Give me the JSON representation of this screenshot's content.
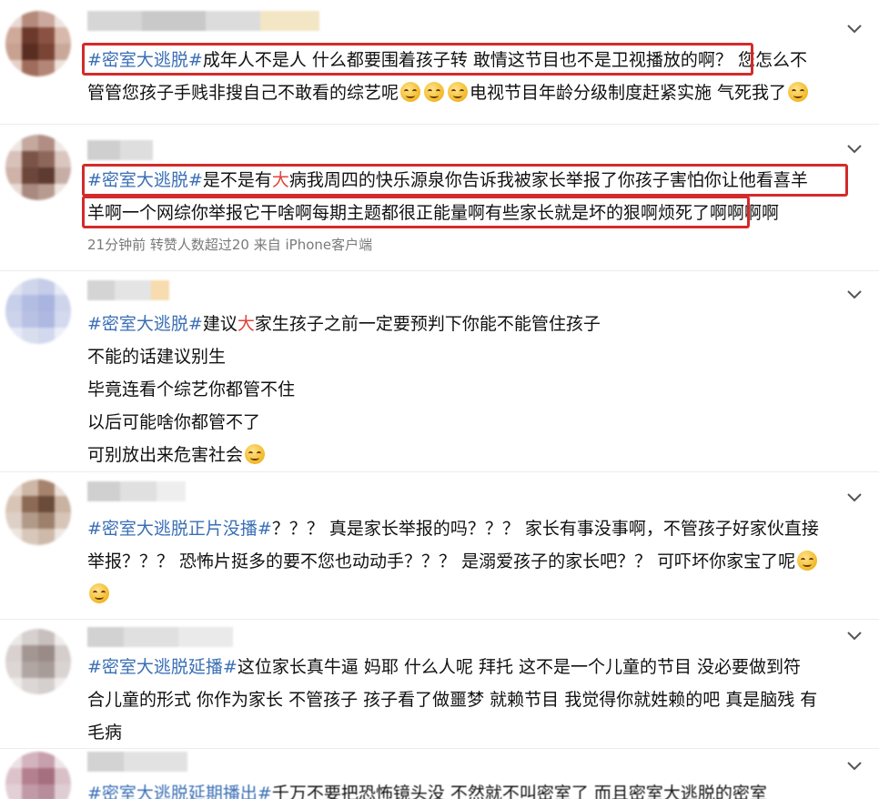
{
  "comments": [
    {
      "lines": [
        {
          "tag": "#密室大逃脱#",
          "text": "成年人不是人 什么都要围着孩子转 敢情这节目也不是卫视播放的啊？ 您怎么不"
        },
        {
          "text_a": "管管您孩子手贱非搜自己不敢看的综艺呢",
          "text_b": "电视节目年龄分级制度赶紧实施 气死我了"
        }
      ]
    },
    {
      "lines": [
        {
          "tag": "#密室大逃脱#",
          "pre": "是不是有",
          "red": "大",
          "text": "病我周四的快乐源泉你告诉我被家长举报了你孩子害怕你让他看喜羊"
        },
        {
          "text": "羊啊一个网综你举报它干啥啊每期主题都很正能量啊有些家长就是坏的狠啊烦死了",
          "tail": "啊啊啊啊"
        }
      ],
      "meta": "21分钟前 转赞人数超过20  来自 iPhone客户端"
    },
    {
      "lines": [
        {
          "tag": "#密室大逃脱#",
          "pre": "建议",
          "red": "大",
          "text": "家生孩子之前一定要预判下你能不能管住孩子"
        },
        {
          "text": "不能的话建议别生"
        },
        {
          "text": "毕竟连看个综艺你都管不住"
        },
        {
          "text": "以后可能啥你都管不了"
        },
        {
          "text": "可别放出来危害社会"
        }
      ]
    },
    {
      "lines": [
        {
          "tag": "#密室大逃脱正片没播#",
          "text": "？？？ 真是家长举报的吗？？？ 家长有事没事啊，不管孩子好家伙直接"
        },
        {
          "text": "举报？？？ 恐怖片挺多的要不您也动动手？？？ 是溺爱孩子的家长吧？？ 可吓坏你家宝了呢"
        }
      ]
    },
    {
      "lines": [
        {
          "tag": "#密室大逃脱延播#",
          "text": "这位家长真牛逼 妈耶 什么人呢 拜托 这不是一个儿童的节目 没必要做到符"
        },
        {
          "text": "合儿童的形式 你作为家长 不管孩子 孩子看了做噩梦 就赖节目 我觉得你就姓赖的吧 真是脑残 有"
        },
        {
          "text": "毛病"
        }
      ]
    },
    {
      "lines": [
        {
          "tag": "#密室大逃脱延期播出#",
          "text": "千万不要把恐怖镜头没 不然就不叫密室了 而且密室大逃脱的密室"
        }
      ]
    }
  ],
  "icons": {
    "expand": "chevron-down-icon",
    "emoji": "smile-emoji-icon"
  },
  "colors": {
    "tag": "#3a6fb5",
    "highlight_box": "#d42a2a",
    "meta": "#7a7a7a"
  }
}
